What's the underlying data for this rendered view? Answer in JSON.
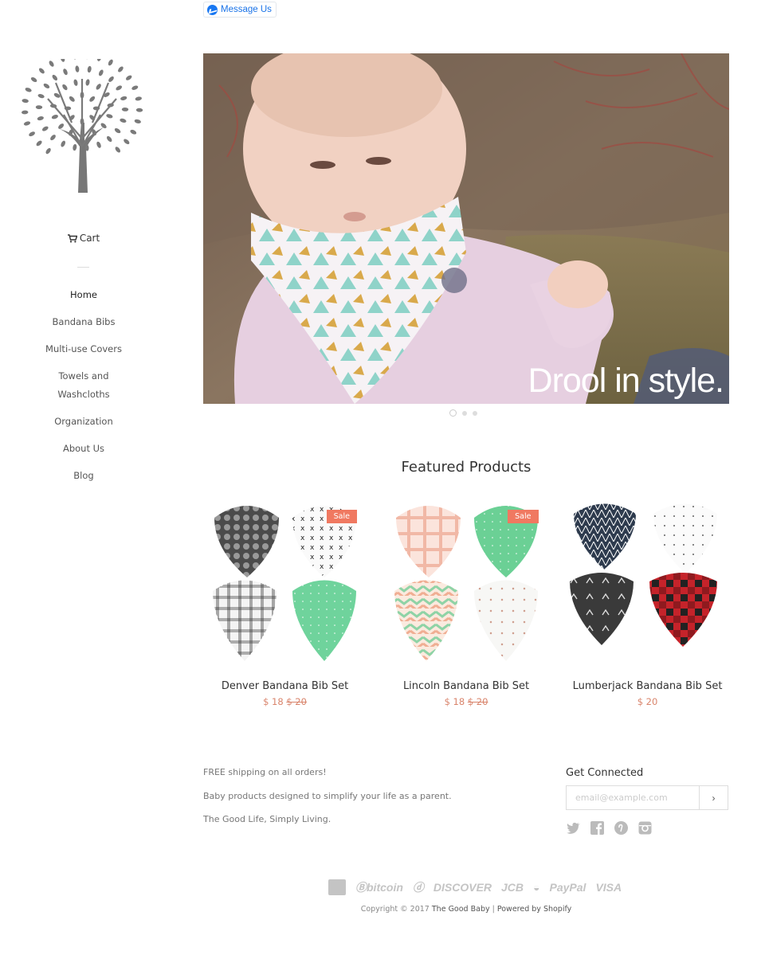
{
  "messenger": {
    "label": "Message Us"
  },
  "sidebar": {
    "cart_label": "Cart",
    "nav": [
      {
        "label": "Home"
      },
      {
        "label": "Bandana Bibs"
      },
      {
        "label": "Multi-use Covers"
      },
      {
        "label": "Towels and Washcloths"
      },
      {
        "label": "Organization"
      },
      {
        "label": "About Us"
      },
      {
        "label": "Blog"
      }
    ]
  },
  "hero": {
    "caption": "Drool in style.",
    "slide_count": 3,
    "active_slide": 1
  },
  "featured": {
    "title": "Featured Products",
    "products": [
      {
        "name": "Denver Bandana Bib Set",
        "price": "$ 18",
        "compare_price": "$ 20",
        "badge": "Sale"
      },
      {
        "name": "Lincoln Bandana Bib Set",
        "price": "$ 18",
        "compare_price": "$ 20",
        "badge": "Sale"
      },
      {
        "name": "Lumberjack Bandana Bib Set",
        "price": "$ 20",
        "compare_price": "",
        "badge": ""
      }
    ]
  },
  "footer": {
    "lines": [
      "FREE shipping on all orders!",
      "Baby products designed to simplify your life as a parent.",
      "The Good Life, Simply Living."
    ],
    "connect_title": "Get Connected",
    "email_placeholder": "email@example.com",
    "submit_label": "›",
    "social": [
      "twitter-icon",
      "facebook-icon",
      "pinterest-icon",
      "instagram-icon"
    ],
    "payments": [
      "bitcoin",
      "DISCOVER",
      "JCB",
      "PayPal",
      "VISA"
    ],
    "copyright_prefix": "Copyright © 2017",
    "store_name": "The Good Baby",
    "separator": "|",
    "powered": "Powered by Shopify"
  },
  "colors": {
    "accent": "#f07961",
    "price": "#d9846b",
    "messenger": "#1877f2"
  }
}
